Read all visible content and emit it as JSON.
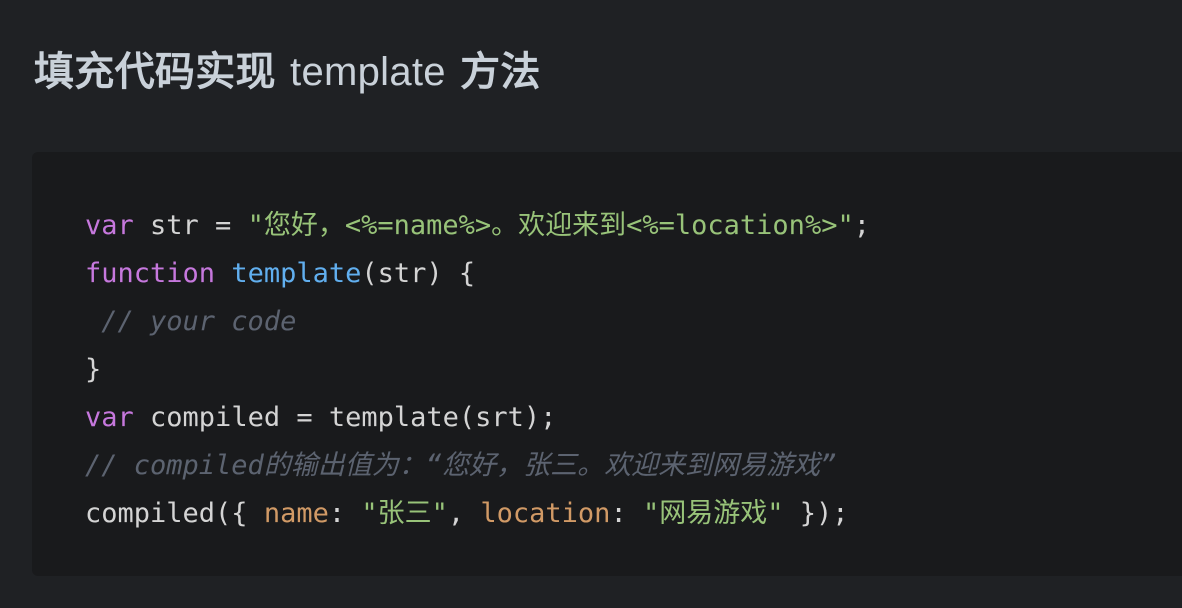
{
  "heading": {
    "zh_prefix": "填充代码实现 ",
    "latin": "template",
    "zh_suffix": " 方法"
  },
  "code": {
    "line1": {
      "kw": "var",
      "rest": " str = ",
      "str": "\"您好，<%=name%>。欢迎来到<%=location%>\"",
      "end": ";"
    },
    "line2": {
      "kw": "function",
      "sp": " ",
      "fn": "template",
      "rest": "(str) {"
    },
    "line3": {
      "comment": " // your code"
    },
    "line4": {
      "brace": "}"
    },
    "line5": {
      "kw": "var",
      "rest": " compiled = template(srt);"
    },
    "line6": {
      "comment": "// compiled的输出值为：“您好，张三。欢迎来到网易游戏”"
    },
    "line7": {
      "a": "compiled({ ",
      "prop1": "name",
      "b": ": ",
      "str1": "\"张三\"",
      "c": ", ",
      "prop2": "location",
      "d": ": ",
      "str2": "\"网易游戏\"",
      "e": " });"
    }
  },
  "colors": {
    "background": "#1f2124",
    "code_background": "#191a1c",
    "keyword": "#c678dd",
    "function": "#61afef",
    "string": "#98c379",
    "property": "#d19a66",
    "comment": "#5c6370",
    "text": "#d4d4d4"
  }
}
